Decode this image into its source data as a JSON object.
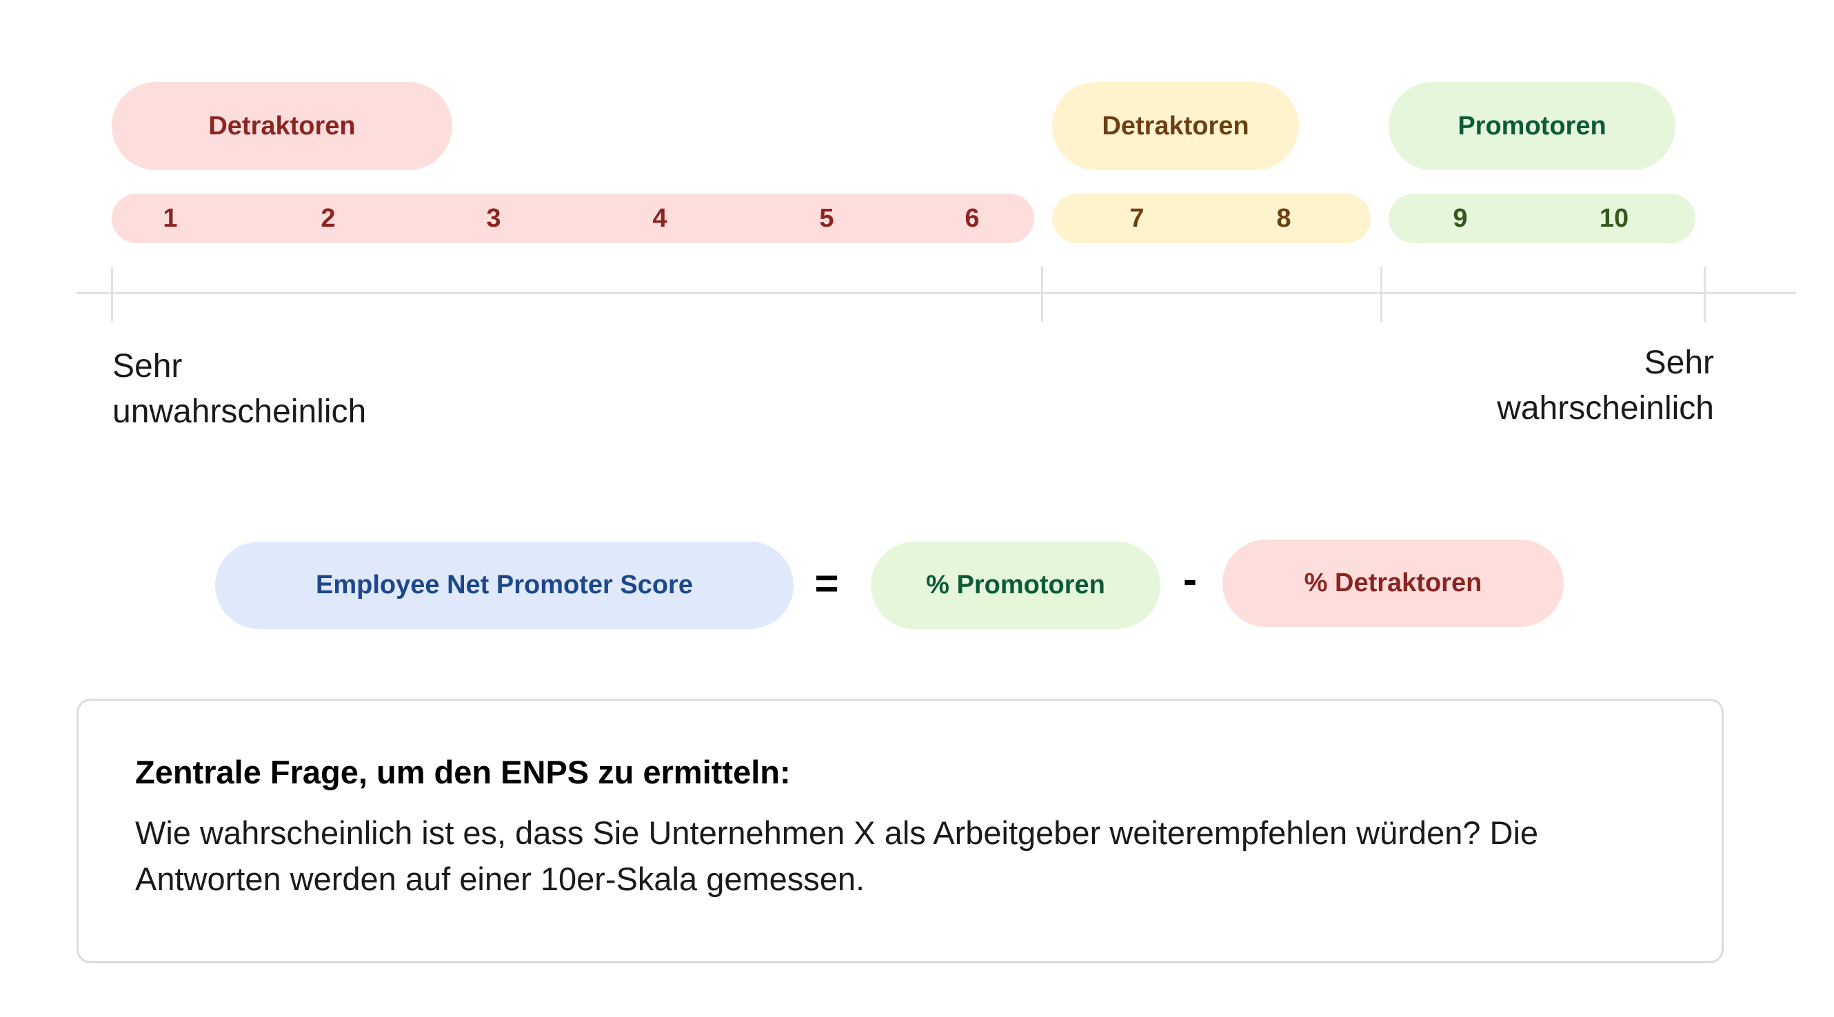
{
  "scale": {
    "group_labels": [
      {
        "label": "Detraktoren",
        "group": "detractors",
        "range": [
          1,
          6
        ]
      },
      {
        "label": "Detraktoren",
        "group": "passives",
        "range": [
          7,
          8
        ]
      },
      {
        "label": "Promotoren",
        "group": "promoters",
        "range": [
          9,
          10
        ]
      }
    ],
    "numbers": [
      "1",
      "2",
      "3",
      "4",
      "5",
      "6",
      "7",
      "8",
      "9",
      "10"
    ],
    "low_label_line1": "Sehr",
    "low_label_line2": "unwahrscheinlich",
    "high_label_line1": "Sehr",
    "high_label_line2": "wahrscheinlich"
  },
  "formula": {
    "result": "Employee Net Promoter Score",
    "equals": "=",
    "term1": "% Promotoren",
    "minus": "-",
    "term2": "% Detraktoren"
  },
  "card": {
    "title": "Zentrale Frage, um den ENPS zu ermitteln:",
    "body": "Wie wahrscheinlich ist es, dass Sie Unternehmen X als Arbeitgeber weiterempfehlen würden? Die Antworten werden auf einer 10er-Skala gemessen."
  },
  "colors": {
    "detractor_bg": "#fddedc",
    "detractor_text": "#8a2522",
    "passive_bg": "#fef3cc",
    "passive_text": "#6b4012",
    "promoter_bg": "#e6f6da",
    "promoter_text": "#0b5a38",
    "score_bg": "#dfe9fb",
    "score_text": "#1c478b"
  }
}
